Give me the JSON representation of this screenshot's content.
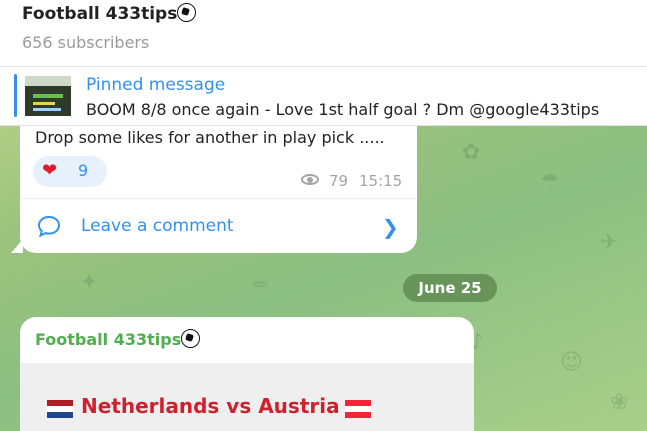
{
  "channel": {
    "name": "Football 433tips",
    "subscribers": "656 subscribers"
  },
  "pinned": {
    "title": "Pinned message",
    "text": "BOOM 8/8 once again - Love 1st half goal ? Dm @google433tips"
  },
  "message1": {
    "text": "Drop some likes for another in play pick .....",
    "reaction_icon": "heart-icon",
    "reaction_count": "9",
    "views": "79",
    "time": "15:15",
    "comment_label": "Leave a comment"
  },
  "date_separator": "June 25",
  "message2": {
    "author": "Football 433tips",
    "match": "Netherlands vs Austria",
    "colors": {
      "netherlands_flag": [
        "#ae1c28",
        "#ffffff",
        "#21468b"
      ],
      "austria_flag": [
        "#ed2939",
        "#ffffff",
        "#ed2939"
      ],
      "match_text": "#d0202e"
    }
  },
  "colors": {
    "accent": "#3390ec",
    "author": "#4fae4e",
    "reaction_bg": "#e6f1fc"
  }
}
